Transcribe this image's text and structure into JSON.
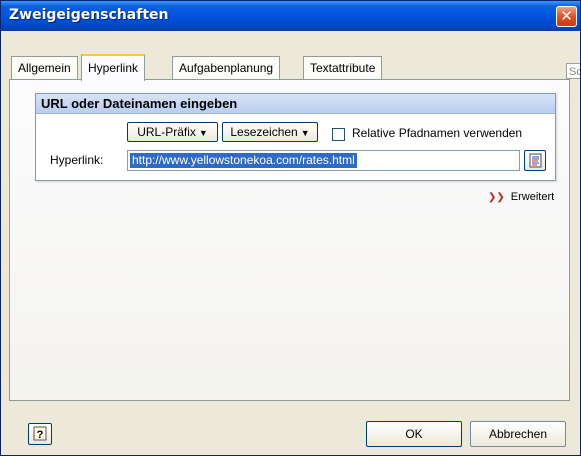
{
  "window": {
    "title": "Zweigeigenschaften"
  },
  "tabs": [
    {
      "label": "Allgemein"
    },
    {
      "label": "Hyperlink"
    },
    {
      "label": "Aufgabenplanung"
    },
    {
      "label": "Textattribute"
    }
  ],
  "tab_overflow_label": "Schli",
  "group": {
    "title": "URL oder Dateinamen eingeben",
    "url_prefix_label": "URL-Präfix",
    "bookmarks_label": "Lesezeichen",
    "relative_paths_label": "Relative Pfadnamen verwenden",
    "relative_paths_checked": false,
    "hyperlink_label": "Hyperlink:",
    "hyperlink_value": "http://www.yellowstonekoa.com/rates.html"
  },
  "advanced_label": "Erweitert",
  "footer": {
    "ok_label": "OK",
    "cancel_label": "Abbrechen"
  },
  "colors": {
    "title_bar": "#0054e3",
    "selection": "#316ac5",
    "accent": "#ffc83c"
  },
  "icons": {
    "close": "close-icon",
    "dropdown": "caret-down-icon",
    "browse": "browse-file-icon",
    "advanced": "chevron-double-down-icon",
    "help": "help-icon"
  }
}
